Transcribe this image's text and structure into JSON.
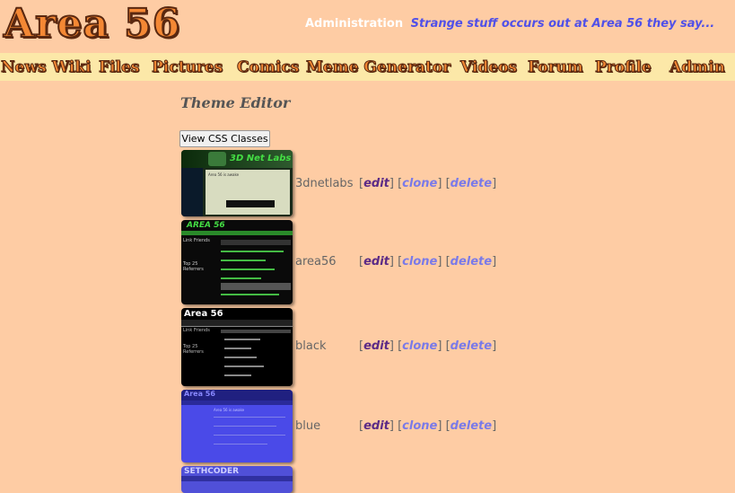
{
  "header": {
    "logo_text": "Area 56",
    "admin_label": "Administration",
    "slogan": "Strange stuff occurs out at Area 56 they say..."
  },
  "nav": {
    "items": [
      "News",
      "Wiki",
      "Files",
      "Pictures",
      "Comics",
      "Meme Generator",
      "Videos",
      "Forum",
      "Profile",
      "Admin"
    ]
  },
  "page": {
    "title": "Theme Editor",
    "view_css_button": "View CSS Classes"
  },
  "themes": [
    {
      "name": "3dnetlabs",
      "thumb_title": "3D Net Labs",
      "thumb_heading": "Area 56 is awake"
    },
    {
      "name": "area56",
      "thumb_title": "AREA 56",
      "thumb_sidebar_1": "Link Friends",
      "thumb_sidebar_2": "Top 25 Referrers"
    },
    {
      "name": "black",
      "thumb_title": "Area 56",
      "thumb_sidebar_1": "Link Friends",
      "thumb_sidebar_2": "Top 25 Referrers"
    },
    {
      "name": "blue",
      "thumb_title": "Area 56",
      "thumb_heading": "Area 56 is awake"
    },
    {
      "name": "",
      "thumb_title": "SETHCODER"
    }
  ],
  "actions": {
    "edit": "edit",
    "clone": "clone",
    "delete": "delete",
    "open_bracket": "[",
    "close_bracket": "]"
  },
  "colors": {
    "background": "#fecca4",
    "nav_background": "#fce8a8",
    "logo_orange": "#f48834",
    "slogan_blue": "#5050e8",
    "edit_link": "#5b2a86",
    "other_link": "#7a7ae8"
  }
}
